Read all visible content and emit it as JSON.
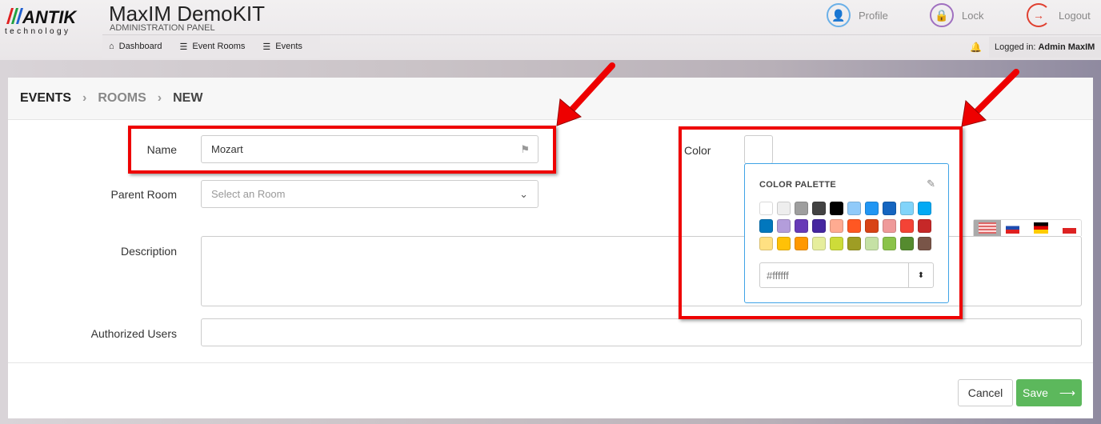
{
  "header": {
    "logo_text": "ANTIK",
    "logo_sub": "technology",
    "title": "MaxIM DemoKIT",
    "subtitle": "ADMINISTRATION PANEL",
    "nav": [
      {
        "label": "Dashboard",
        "icon": "home-icon"
      },
      {
        "label": "Event Rooms",
        "icon": "list-icon"
      },
      {
        "label": "Events",
        "icon": "list-icon"
      }
    ],
    "profile": "Profile",
    "lock": "Lock",
    "logout": "Logout",
    "logged_prefix": "Logged in:",
    "logged_user": "Admin MaxIM"
  },
  "breadcrumb": [
    "EVENTS",
    "ROOMS",
    "NEW"
  ],
  "form": {
    "name_label": "Name",
    "name_value": "Mozart",
    "parent_label": "Parent Room",
    "parent_placeholder": "Select an Room",
    "description_label": "Description",
    "authorized_label": "Authorized Users",
    "color_label": "Color"
  },
  "palette": {
    "title": "COLOR PALETTE",
    "hex_value": "#ffffff",
    "colors": [
      "#ffffff",
      "#eeeeee",
      "#9e9e9e",
      "#424242",
      "#000000",
      "#90caf9",
      "#2196f3",
      "#1565c0",
      "#81d4fa",
      "#03a9f4",
      "#0277bd",
      "#b39ddb",
      "#673ab7",
      "#4527a0",
      "#ffab91",
      "#ff5722",
      "#d84315",
      "#ef9a9a",
      "#f44336",
      "#c62828",
      "#ffe082",
      "#ffc107",
      "#ff9800",
      "#e6ee9c",
      "#cddc39",
      "#9e9d24",
      "#c5e1a5",
      "#8bc34a",
      "#558b2f",
      "#795548"
    ]
  },
  "languages": [
    "en",
    "sk",
    "de",
    "cz"
  ],
  "footer": {
    "cancel": "Cancel",
    "save": "Save"
  }
}
